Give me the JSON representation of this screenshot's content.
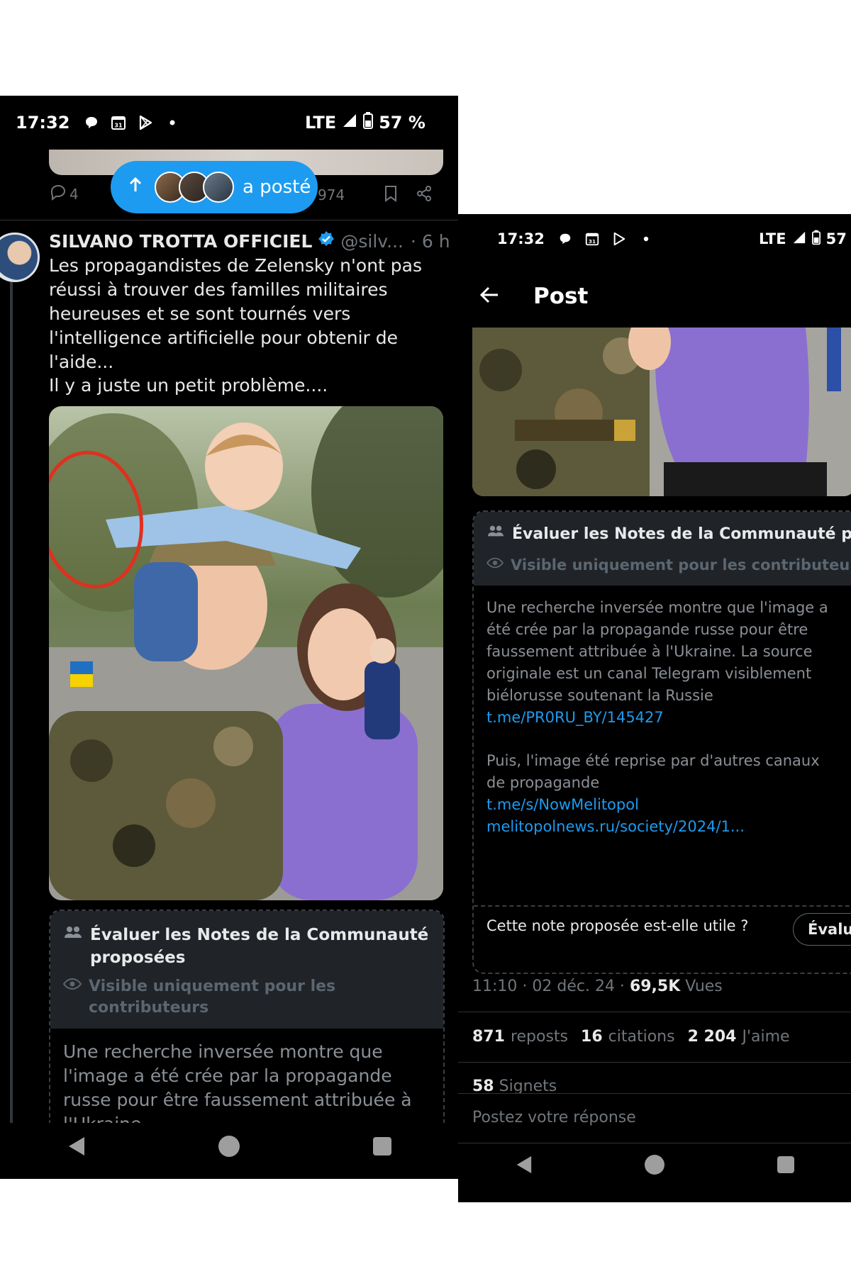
{
  "left": {
    "status": {
      "time": "17:32",
      "network": "LTE",
      "battery": "57 %"
    },
    "repost_pill": {
      "label": "a posté"
    },
    "prev_actions": {
      "replies": "4",
      "views_partial": "974"
    },
    "tweet": {
      "author_name": "SILVANO TROTTA OFFICIEL",
      "handle": "@silv...",
      "time": "· 6 h",
      "text1": "Les propagandistes de Zelensky n'ont pas réussi à trouver des familles militaires heureuses et se sont tournés vers l'intelligence artificielle pour obtenir de l'aide...",
      "text2": "Il y a juste un petit problème...."
    },
    "community_note": {
      "title": "Évaluer les Notes de la Communauté proposées",
      "visibility": "Visible uniquement pour les contributeurs",
      "body": "Une recherche inversée  montre que l'image a été crée par la propagande russe pour être faussement attribuée à l'Ukraine"
    }
  },
  "right": {
    "status": {
      "time": "17:32",
      "network": "LTE",
      "battery": "57"
    },
    "header": {
      "title": "Post"
    },
    "community_note": {
      "title": "Évaluer les Notes de la Communauté proposé",
      "visibility": "Visible uniquement pour les contributeurs",
      "body1": "Une recherche inversée  montre que l'image a été crée par la propagande russe pour être faussement attribuée à l'Ukraine. La source originale est un canal Telegram visiblement biélorusse soutenant la Russie",
      "link1": "t.me/PR0RU_BY/145427",
      "body2": "Puis, l'image été reprise par d'autres canaux de propagande",
      "link2": "t.me/s/NowMelitopol",
      "link3": "melitopolnews.ru/society/2024/1...",
      "question": "Cette note proposée est-elle utile ?",
      "rate_button": "Évalue"
    },
    "meta": {
      "timestamp": "11:10 · 02 déc. 24 · ",
      "views_count": "69,5K",
      "views_label": " Vues"
    },
    "stats": {
      "reposts_count": "871",
      "reposts_label": "reposts",
      "quotes_count": "16",
      "quotes_label": "citations",
      "likes_count": "2 204",
      "likes_label": "J'aime",
      "bookmarks_count": "58",
      "bookmarks_label": "Signets"
    },
    "reply": {
      "placeholder": "Postez votre réponse"
    }
  },
  "colors": {
    "accent": "#1d9bf0",
    "background": "#000000",
    "note_header": "#202327",
    "annotation_circle": "#e0301e"
  }
}
